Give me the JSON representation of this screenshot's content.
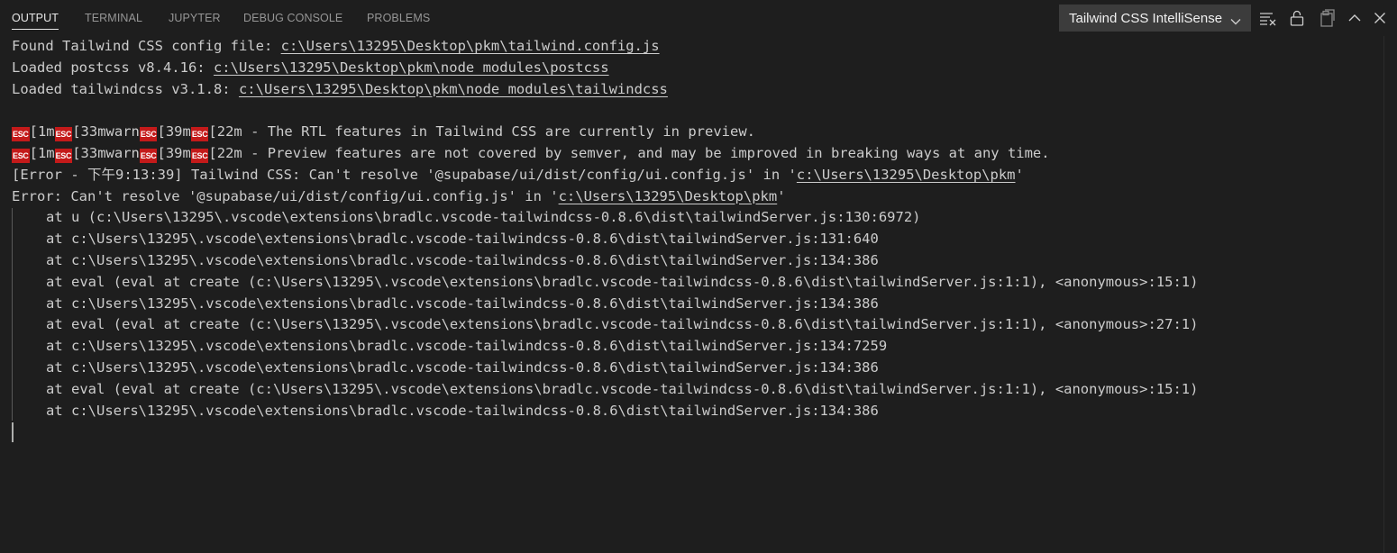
{
  "tabs": [
    {
      "label": "OUTPUT",
      "active": true
    },
    {
      "label": "TERMINAL",
      "active": false
    },
    {
      "label": "JUPYTER",
      "active": false
    },
    {
      "label": "DEBUG CONSOLE",
      "active": false
    },
    {
      "label": "PROBLEMS",
      "active": false
    }
  ],
  "channel": {
    "selected": "Tailwind CSS IntelliSense"
  },
  "actions": [
    "clear-output-icon",
    "lock-icon",
    "open-in-editor-icon",
    "chevron-up-icon",
    "close-icon"
  ],
  "colors": {
    "background": "#1e1e1e",
    "text": "#cccccc",
    "esc_badge": "#c41a1a"
  },
  "output": {
    "line1": {
      "text": "Found Tailwind CSS config file: ",
      "link": "c:\\Users\\13295\\Desktop\\pkm\\tailwind.config.js"
    },
    "line2": {
      "text": "Loaded postcss v8.4.16: ",
      "link": "c:\\Users\\13295\\Desktop\\pkm\\node_modules\\postcss"
    },
    "line3": {
      "text": "Loaded tailwindcss v3.1.8: ",
      "link": "c:\\Users\\13295\\Desktop\\pkm\\node_modules\\tailwindcss"
    },
    "esc_label": "ESC",
    "warn1": {
      "p1": "[1m",
      "p2": "[33mwarn",
      "p3": "[39m",
      "p4": "[22m - The RTL features in Tailwind CSS are currently in preview."
    },
    "warn2": {
      "p1": "[1m",
      "p2": "[33mwarn",
      "p3": "[39m",
      "p4": "[22m - Preview features are not covered by semver, and may be improved in breaking ways at any time."
    },
    "error1": {
      "text": "[Error - 下午9:13:39] Tailwind CSS: Can't resolve '@supabase/ui/dist/config/ui.config.js' in '",
      "link": "c:\\Users\\13295\\Desktop\\pkm",
      "suffix": "'"
    },
    "error2": {
      "text": "Error: Can't resolve '@supabase/ui/dist/config/ui.config.js' in '",
      "link": "c:\\Users\\13295\\Desktop\\pkm",
      "suffix": "'"
    },
    "stack": [
      "at u (c:\\Users\\13295\\.vscode\\extensions\\bradlc.vscode-tailwindcss-0.8.6\\dist\\tailwindServer.js:130:6972)",
      "at c:\\Users\\13295\\.vscode\\extensions\\bradlc.vscode-tailwindcss-0.8.6\\dist\\tailwindServer.js:131:640",
      "at c:\\Users\\13295\\.vscode\\extensions\\bradlc.vscode-tailwindcss-0.8.6\\dist\\tailwindServer.js:134:386",
      "at eval (eval at create (c:\\Users\\13295\\.vscode\\extensions\\bradlc.vscode-tailwindcss-0.8.6\\dist\\tailwindServer.js:1:1), <anonymous>:15:1)",
      "at c:\\Users\\13295\\.vscode\\extensions\\bradlc.vscode-tailwindcss-0.8.6\\dist\\tailwindServer.js:134:386",
      "at eval (eval at create (c:\\Users\\13295\\.vscode\\extensions\\bradlc.vscode-tailwindcss-0.8.6\\dist\\tailwindServer.js:1:1), <anonymous>:27:1)",
      "at c:\\Users\\13295\\.vscode\\extensions\\bradlc.vscode-tailwindcss-0.8.6\\dist\\tailwindServer.js:134:7259",
      "at c:\\Users\\13295\\.vscode\\extensions\\bradlc.vscode-tailwindcss-0.8.6\\dist\\tailwindServer.js:134:386",
      "at eval (eval at create (c:\\Users\\13295\\.vscode\\extensions\\bradlc.vscode-tailwindcss-0.8.6\\dist\\tailwindServer.js:1:1), <anonymous>:15:1)",
      "at c:\\Users\\13295\\.vscode\\extensions\\bradlc.vscode-tailwindcss-0.8.6\\dist\\tailwindServer.js:134:386"
    ]
  }
}
